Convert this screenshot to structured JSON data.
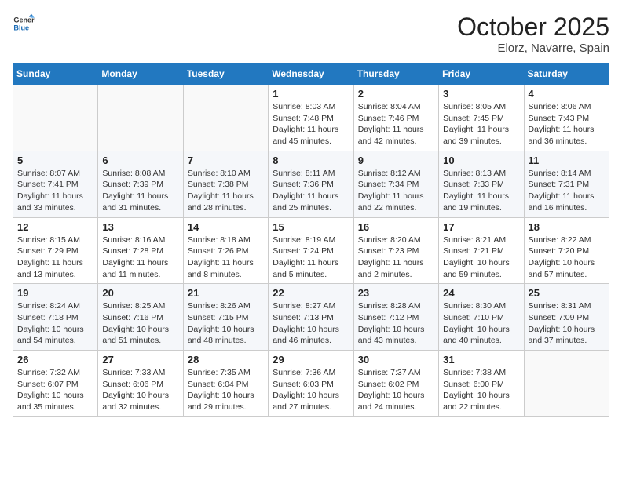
{
  "logo": {
    "line1": "General",
    "line2": "Blue"
  },
  "title": "October 2025",
  "subtitle": "Elorz, Navarre, Spain",
  "days_of_week": [
    "Sunday",
    "Monday",
    "Tuesday",
    "Wednesday",
    "Thursday",
    "Friday",
    "Saturday"
  ],
  "weeks": [
    [
      {
        "day": "",
        "info": ""
      },
      {
        "day": "",
        "info": ""
      },
      {
        "day": "",
        "info": ""
      },
      {
        "day": "1",
        "info": "Sunrise: 8:03 AM\nSunset: 7:48 PM\nDaylight: 11 hours and 45 minutes."
      },
      {
        "day": "2",
        "info": "Sunrise: 8:04 AM\nSunset: 7:46 PM\nDaylight: 11 hours and 42 minutes."
      },
      {
        "day": "3",
        "info": "Sunrise: 8:05 AM\nSunset: 7:45 PM\nDaylight: 11 hours and 39 minutes."
      },
      {
        "day": "4",
        "info": "Sunrise: 8:06 AM\nSunset: 7:43 PM\nDaylight: 11 hours and 36 minutes."
      }
    ],
    [
      {
        "day": "5",
        "info": "Sunrise: 8:07 AM\nSunset: 7:41 PM\nDaylight: 11 hours and 33 minutes."
      },
      {
        "day": "6",
        "info": "Sunrise: 8:08 AM\nSunset: 7:39 PM\nDaylight: 11 hours and 31 minutes."
      },
      {
        "day": "7",
        "info": "Sunrise: 8:10 AM\nSunset: 7:38 PM\nDaylight: 11 hours and 28 minutes."
      },
      {
        "day": "8",
        "info": "Sunrise: 8:11 AM\nSunset: 7:36 PM\nDaylight: 11 hours and 25 minutes."
      },
      {
        "day": "9",
        "info": "Sunrise: 8:12 AM\nSunset: 7:34 PM\nDaylight: 11 hours and 22 minutes."
      },
      {
        "day": "10",
        "info": "Sunrise: 8:13 AM\nSunset: 7:33 PM\nDaylight: 11 hours and 19 minutes."
      },
      {
        "day": "11",
        "info": "Sunrise: 8:14 AM\nSunset: 7:31 PM\nDaylight: 11 hours and 16 minutes."
      }
    ],
    [
      {
        "day": "12",
        "info": "Sunrise: 8:15 AM\nSunset: 7:29 PM\nDaylight: 11 hours and 13 minutes."
      },
      {
        "day": "13",
        "info": "Sunrise: 8:16 AM\nSunset: 7:28 PM\nDaylight: 11 hours and 11 minutes."
      },
      {
        "day": "14",
        "info": "Sunrise: 8:18 AM\nSunset: 7:26 PM\nDaylight: 11 hours and 8 minutes."
      },
      {
        "day": "15",
        "info": "Sunrise: 8:19 AM\nSunset: 7:24 PM\nDaylight: 11 hours and 5 minutes."
      },
      {
        "day": "16",
        "info": "Sunrise: 8:20 AM\nSunset: 7:23 PM\nDaylight: 11 hours and 2 minutes."
      },
      {
        "day": "17",
        "info": "Sunrise: 8:21 AM\nSunset: 7:21 PM\nDaylight: 10 hours and 59 minutes."
      },
      {
        "day": "18",
        "info": "Sunrise: 8:22 AM\nSunset: 7:20 PM\nDaylight: 10 hours and 57 minutes."
      }
    ],
    [
      {
        "day": "19",
        "info": "Sunrise: 8:24 AM\nSunset: 7:18 PM\nDaylight: 10 hours and 54 minutes."
      },
      {
        "day": "20",
        "info": "Sunrise: 8:25 AM\nSunset: 7:16 PM\nDaylight: 10 hours and 51 minutes."
      },
      {
        "day": "21",
        "info": "Sunrise: 8:26 AM\nSunset: 7:15 PM\nDaylight: 10 hours and 48 minutes."
      },
      {
        "day": "22",
        "info": "Sunrise: 8:27 AM\nSunset: 7:13 PM\nDaylight: 10 hours and 46 minutes."
      },
      {
        "day": "23",
        "info": "Sunrise: 8:28 AM\nSunset: 7:12 PM\nDaylight: 10 hours and 43 minutes."
      },
      {
        "day": "24",
        "info": "Sunrise: 8:30 AM\nSunset: 7:10 PM\nDaylight: 10 hours and 40 minutes."
      },
      {
        "day": "25",
        "info": "Sunrise: 8:31 AM\nSunset: 7:09 PM\nDaylight: 10 hours and 37 minutes."
      }
    ],
    [
      {
        "day": "26",
        "info": "Sunrise: 7:32 AM\nSunset: 6:07 PM\nDaylight: 10 hours and 35 minutes."
      },
      {
        "day": "27",
        "info": "Sunrise: 7:33 AM\nSunset: 6:06 PM\nDaylight: 10 hours and 32 minutes."
      },
      {
        "day": "28",
        "info": "Sunrise: 7:35 AM\nSunset: 6:04 PM\nDaylight: 10 hours and 29 minutes."
      },
      {
        "day": "29",
        "info": "Sunrise: 7:36 AM\nSunset: 6:03 PM\nDaylight: 10 hours and 27 minutes."
      },
      {
        "day": "30",
        "info": "Sunrise: 7:37 AM\nSunset: 6:02 PM\nDaylight: 10 hours and 24 minutes."
      },
      {
        "day": "31",
        "info": "Sunrise: 7:38 AM\nSunset: 6:00 PM\nDaylight: 10 hours and 22 minutes."
      },
      {
        "day": "",
        "info": ""
      }
    ]
  ]
}
